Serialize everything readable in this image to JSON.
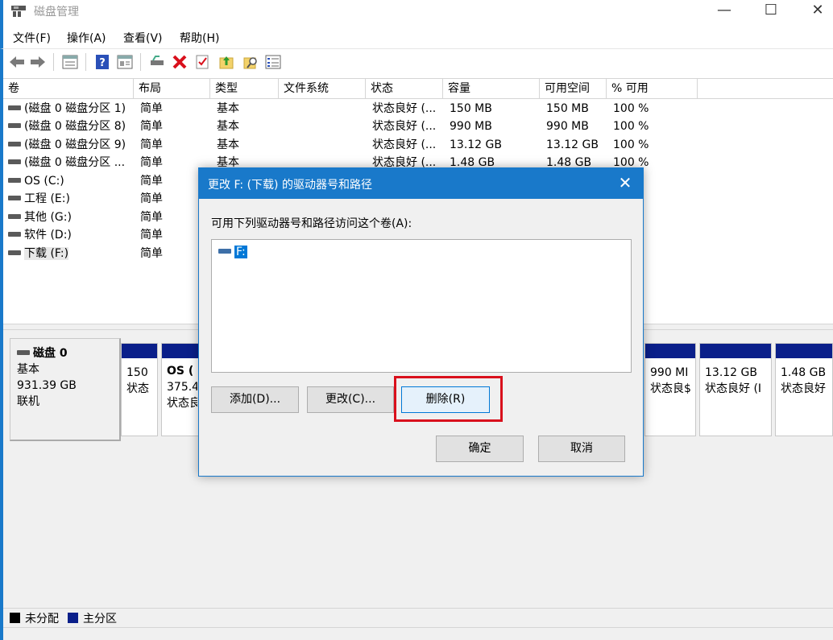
{
  "window": {
    "title": "磁盘管理",
    "min_glyph": "—",
    "max_glyph": "☐",
    "close_glyph": "✕"
  },
  "menu": [
    {
      "label": "文件(F)"
    },
    {
      "label": "操作(A)"
    },
    {
      "label": "查看(V)"
    },
    {
      "label": "帮助(H)"
    }
  ],
  "toolbar": {
    "icons": [
      "back-icon",
      "forward-icon",
      "properties-icon",
      "help-icon",
      "view-icon",
      "connect-drive-icon",
      "delete-icon",
      "check-icon",
      "up-folder-icon",
      "search-folder-icon",
      "list-icon"
    ],
    "delete_color": "#d9101c"
  },
  "volume_table": {
    "headers": [
      "卷",
      "布局",
      "类型",
      "文件系统",
      "状态",
      "容量",
      "可用空间",
      "% 可用"
    ],
    "rows": [
      [
        "(磁盘 0 磁盘分区 1)",
        "简单",
        "基本",
        "",
        "状态良好 (...",
        "150 MB",
        "150 MB",
        "100 %"
      ],
      [
        "(磁盘 0 磁盘分区 8)",
        "简单",
        "基本",
        "",
        "状态良好 (...",
        "990 MB",
        "990 MB",
        "100 %"
      ],
      [
        "(磁盘 0 磁盘分区 9)",
        "简单",
        "基本",
        "",
        "状态良好 (...",
        "13.12 GB",
        "13.12 GB",
        "100 %"
      ],
      [
        "(磁盘 0 磁盘分区 ...",
        "简单",
        "基本",
        "",
        "状态良好 (...",
        "1.48 GB",
        "1.48 GB",
        "100 %"
      ],
      [
        "OS (C:)",
        "简单",
        "",
        "",
        "",
        "",
        "",
        ""
      ],
      [
        "工程 (E:)",
        "简单",
        "",
        "",
        "",
        "",
        "",
        ""
      ],
      [
        "其他 (G:)",
        "简单",
        "",
        "",
        "",
        "",
        "",
        ""
      ],
      [
        "软件 (D:)",
        "简单",
        "",
        "",
        "",
        "",
        "",
        ""
      ],
      [
        "下载 (F:)",
        "简单",
        "",
        "",
        "",
        "",
        "",
        ""
      ]
    ]
  },
  "disk": {
    "name": "磁盘 0",
    "type": "基本",
    "size": "931.39 GB",
    "status": "联机",
    "partitions": [
      {
        "line1": "150",
        "line2": "状态",
        "bold": false
      },
      {
        "line0": "OS (",
        "line1": "375.4",
        "line2": "状态良",
        "bold": true
      },
      {
        "line1": "990 MI",
        "line2": "状态良$",
        "bold": false
      },
      {
        "line1": "13.12 GB",
        "line2": "状态良好 (I",
        "bold": false
      },
      {
        "line1": "1.48 GB",
        "line2": "状态良好",
        "bold": false
      }
    ],
    "partition_color": "#0a1f8a"
  },
  "legend": {
    "unallocated": "未分配",
    "primary": "主分区",
    "unallocated_color": "#000000",
    "primary_color": "#0a1f8a"
  },
  "dialog": {
    "title": "更改 F: (下载) 的驱动器号和路径",
    "close_glyph": "✕",
    "prompt": "可用下列驱动器号和路径访问这个卷(A):",
    "list_items": [
      "F:"
    ],
    "add_label": "添加(D)...",
    "change_label": "更改(C)...",
    "remove_label": "删除(R)",
    "ok_label": "确定",
    "cancel_label": "取消",
    "accent_color": "#1979ca",
    "highlight_color": "#d9101c"
  }
}
